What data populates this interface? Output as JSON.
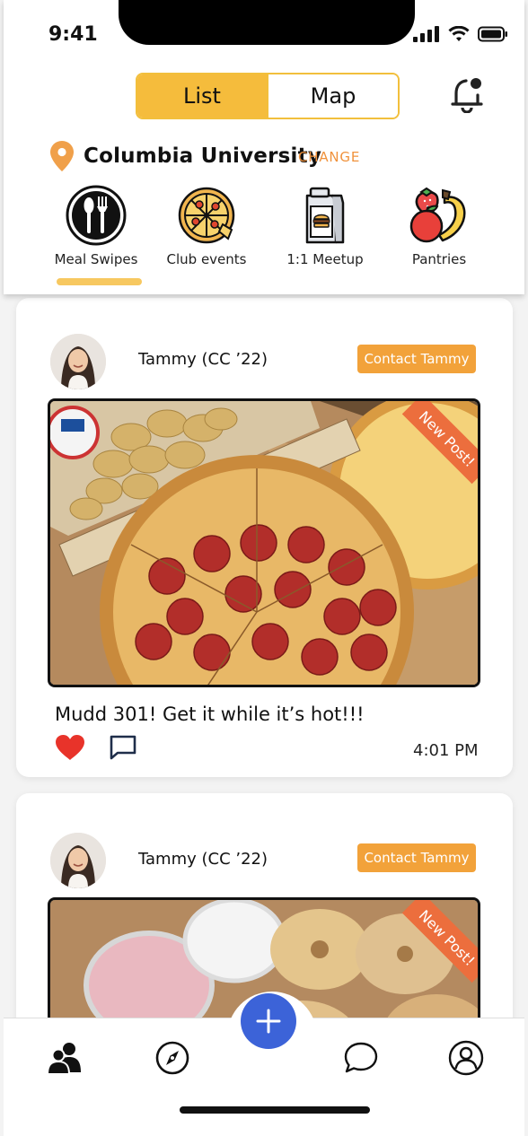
{
  "status_bar": {
    "time": "9:41"
  },
  "view_toggle": {
    "list_label": "List",
    "map_label": "Map",
    "selected": "List"
  },
  "location": {
    "name": "Columbia University",
    "change_label": "CHANGE"
  },
  "categories": [
    {
      "label": "Meal Swipes",
      "icon": "utensils-icon",
      "selected": true
    },
    {
      "label": "Club events",
      "icon": "pizza-icon",
      "selected": false
    },
    {
      "label": "1:1 Meetup",
      "icon": "lunch-bag-icon",
      "selected": false
    },
    {
      "label": "Pantries",
      "icon": "fruit-icon",
      "selected": false
    }
  ],
  "posts": [
    {
      "author": "Tammy (CC ’22)",
      "contact_label": "Contact Tammy",
      "badge": "New Post!",
      "caption": "Mudd 301! Get it while it’s hot!!!",
      "time": "4:01 PM",
      "liked": true,
      "image": "pizza-photo"
    },
    {
      "author": "Tammy (CC ’22)",
      "contact_label": "Contact Tammy",
      "badge": "New Post!",
      "image": "bagels-photo"
    }
  ],
  "bottom_nav": {
    "items": [
      "community-icon",
      "compass-icon",
      "add-icon",
      "chat-icon",
      "profile-icon"
    ]
  },
  "colors": {
    "accent": "#f5bc3c",
    "orange": "#f2a23a",
    "badge": "#ec6e3d",
    "fab": "#3c63d8",
    "like": "#e8332a"
  }
}
